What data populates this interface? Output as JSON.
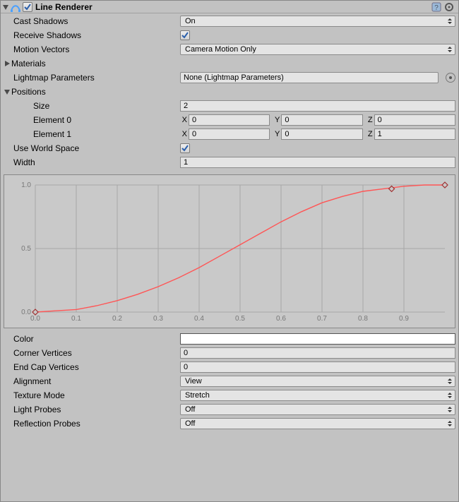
{
  "header": {
    "title": "Line Renderer",
    "enabled": true
  },
  "fields": {
    "castShadows": {
      "label": "Cast Shadows",
      "value": "On"
    },
    "receiveShadows": {
      "label": "Receive Shadows",
      "checked": true
    },
    "motionVectors": {
      "label": "Motion Vectors",
      "value": "Camera Motion Only"
    },
    "materials": {
      "label": "Materials"
    },
    "lightmapParams": {
      "label": "Lightmap Parameters",
      "value": "None (Lightmap Parameters)"
    },
    "positions": {
      "label": "Positions",
      "sizeLabel": "Size",
      "size": "2",
      "elements": [
        {
          "label": "Element 0",
          "x": "0",
          "y": "0",
          "z": "0"
        },
        {
          "label": "Element 1",
          "x": "0",
          "y": "0",
          "z": "1"
        }
      ],
      "axisX": "X",
      "axisY": "Y",
      "axisZ": "Z"
    },
    "useWorldSpace": {
      "label": "Use World Space",
      "checked": true
    },
    "width": {
      "label": "Width",
      "value": "1"
    },
    "color": {
      "label": "Color",
      "value": "#ffffff"
    },
    "cornerVertices": {
      "label": "Corner Vertices",
      "value": "0"
    },
    "endCapVertices": {
      "label": "End Cap Vertices",
      "value": "0"
    },
    "alignment": {
      "label": "Alignment",
      "value": "View"
    },
    "textureMode": {
      "label": "Texture Mode",
      "value": "Stretch"
    },
    "lightProbes": {
      "label": "Light Probes",
      "value": "Off"
    },
    "reflectionProbes": {
      "label": "Reflection Probes",
      "value": "Off"
    }
  },
  "chart_data": {
    "type": "line",
    "title": "",
    "xlabel": "",
    "ylabel": "",
    "xlim": [
      0,
      1
    ],
    "ylim": [
      0,
      1
    ],
    "xticks": [
      0.0,
      0.1,
      0.2,
      0.3,
      0.4,
      0.5,
      0.6,
      0.7,
      0.8,
      0.9
    ],
    "yticks": [
      0.0,
      0.5,
      1.0
    ],
    "keyframes": [
      {
        "x": 0.0,
        "y": 0.0
      },
      {
        "x": 0.87,
        "y": 0.97
      },
      {
        "x": 1.0,
        "y": 1.0
      }
    ],
    "curve_points": [
      [
        0.0,
        0.0
      ],
      [
        0.05,
        0.01
      ],
      [
        0.1,
        0.02
      ],
      [
        0.15,
        0.05
      ],
      [
        0.2,
        0.09
      ],
      [
        0.25,
        0.14
      ],
      [
        0.3,
        0.2
      ],
      [
        0.35,
        0.27
      ],
      [
        0.4,
        0.35
      ],
      [
        0.45,
        0.44
      ],
      [
        0.5,
        0.53
      ],
      [
        0.55,
        0.62
      ],
      [
        0.6,
        0.71
      ],
      [
        0.65,
        0.79
      ],
      [
        0.7,
        0.86
      ],
      [
        0.75,
        0.91
      ],
      [
        0.8,
        0.95
      ],
      [
        0.85,
        0.97
      ],
      [
        0.9,
        0.99
      ],
      [
        0.95,
        1.0
      ],
      [
        1.0,
        1.0
      ]
    ]
  }
}
